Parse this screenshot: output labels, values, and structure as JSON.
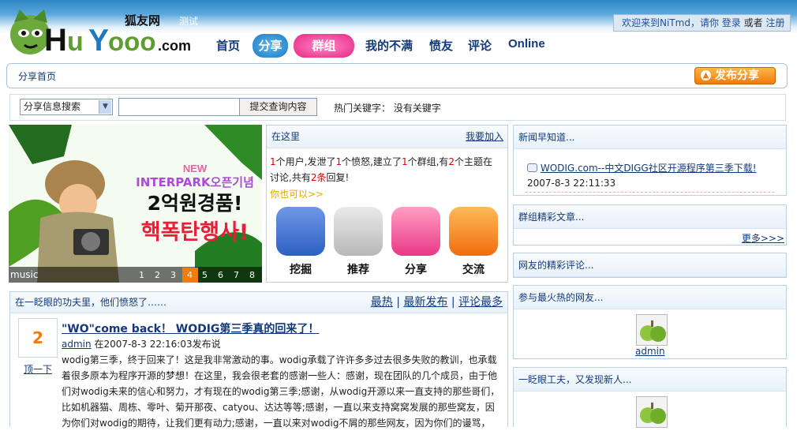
{
  "header": {
    "logo_text": "HuYooo.com",
    "logo_cn": "狐友网",
    "test_label": "测试",
    "welcome_prefix": "欢迎来到NiTmd，请你",
    "login": "登录",
    "or": "或者",
    "register": "注册",
    "nav": [
      "首页",
      "分享",
      "群组",
      "我的不满",
      "愤友",
      "评论",
      "Online"
    ]
  },
  "breadcrumb": {
    "current": "分享首页"
  },
  "publish_button": "发布分享",
  "search": {
    "category": "分享信息搜索",
    "query": "",
    "submit": "提交查询内容",
    "hot_keywords_label": "热门关键字：",
    "hot_keywords_value": "没有关键字"
  },
  "banner": {
    "label": "music",
    "pages": [
      "1",
      "2",
      "3",
      "4",
      "5",
      "6",
      "7",
      "8"
    ],
    "active_page": "4",
    "ad_line1": "NEW",
    "ad_line2": "INTERPARK오픈기념",
    "ad_line3": "2억원경품!",
    "ad_line4": "핵폭탄행사!"
  },
  "here": {
    "title": "在这里",
    "join": "我要加入",
    "stat_users": "1",
    "stat_users_label": "个用户,发泄了",
    "stat_angers": "1",
    "stat_angers_label": "个愤怒,建立了",
    "stat_groups": "1",
    "stat_groups_label": "个群组,有",
    "stat_topics": "2",
    "stat_topics_label": "个主题在讨",
    "stat_topics_label2": "论,共有",
    "stat_replies": "2条",
    "stat_replies_label": "回复!",
    "also": "你也可以>>",
    "actions": [
      "挖掘",
      "推荐",
      "分享",
      "交流"
    ]
  },
  "feed": {
    "title": "在一眨眼的功夫里，他们愤怒了……",
    "tabs": [
      "最热",
      "最新发布",
      "评论最多"
    ],
    "votes": "2",
    "vote_link": "顶一下",
    "article_title": "\"WO\"come back！ WODIG第三季真的回来了！",
    "author": "admin",
    "time": "在2007-8-3 22:16:03发布说",
    "body": "wodig第三季，终于回来了！这是我非常激动的事。wodig承载了许许多多过去很多失败的教训，也承载着很多原本为程序开源的梦想！在这里，我会很老套的感谢一些人：感谢，现在团队的几个成员，由于他们对wodig未来的信心和努力，才有现在的wodig第三季;感谢，从wodig开源以来一直支持的那些哥们，比如机器猫、周栋、零叶、菊开那夜、catyou、达达等等;感谢，一直以来支持窝窝发展的那些窝友，因为你们对wodig的期待，让我们更有动力;感谢，一直以来对wodig不屑的那些网友，因为你们的谩骂，"
  },
  "sidebar": {
    "news": {
      "title": "新闻早知道...",
      "item": "WODIG.com--中文DIGG社区开源程序第三季下载!",
      "date": "2007-8-3 22:11:33"
    },
    "groups": {
      "title": "群组精彩文章...",
      "more": "更多>>>"
    },
    "comments": {
      "title": "网友的精彩评论..."
    },
    "hot_users": {
      "title": "参与最火热的网友...",
      "user": "admin"
    },
    "new_users": {
      "title": "一眨眼工夫，又发现新人..."
    }
  },
  "colors": {
    "primary_blue": "#123a7a",
    "header_blue": "#2f86c4",
    "orange": "#ef7c0c",
    "highlight_red": "#d00"
  }
}
